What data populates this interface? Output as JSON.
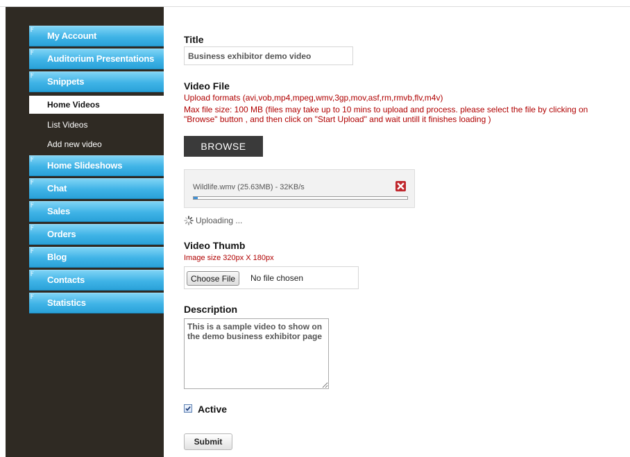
{
  "sidebar": {
    "items": [
      {
        "label": "My Account"
      },
      {
        "label": "Auditorium Presentations"
      },
      {
        "label": "Snippets"
      }
    ],
    "sub_items": [
      {
        "label": "Home Videos",
        "active": true
      },
      {
        "label": "List Videos"
      },
      {
        "label": "Add new video"
      }
    ],
    "items_after": [
      {
        "label": "Home Slideshows"
      },
      {
        "label": "Chat"
      },
      {
        "label": "Sales"
      },
      {
        "label": "Orders"
      },
      {
        "label": "Blog"
      },
      {
        "label": "Contacts"
      },
      {
        "label": "Statistics"
      }
    ]
  },
  "form": {
    "title_label": "Title",
    "title_value": "Business exhibitor demo video",
    "video_file_label": "Video File",
    "upload_formats": "Upload formats (avi,vob,mp4,mpeg,wmv,3gp,mov,asf,rm,rmvb,flv,m4v)",
    "max_size_note": "Max file size: 100 MB (files may take up to 10 mins to upload and process. please select the file by clicking on \"Browse\" button , and then click on \"Start Upload\" and wait untill it finishes loading )",
    "browse_label": "BROWSE",
    "upload_file": "Wildlife.wmv (25.63MB) - 32KB/s",
    "upload_progress": 0.02,
    "uploading_text": "Uploading ...",
    "thumb_label": "Video Thumb",
    "thumb_note": "Image size 320px X 180px",
    "choose_file_label": "Choose File",
    "no_file_text": "No file chosen",
    "description_label": "Description",
    "description_value": "This is a sample video to show on the demo business exhibitor page",
    "active_label": "Active",
    "active_checked": true,
    "submit_label": "Submit"
  },
  "colors": {
    "sidebar_bg": "#2f2a23",
    "nav_blue": "#3fb3e6",
    "note_red": "#b00000",
    "cancel_red": "#c0272d",
    "progress_blue": "#3a8fd8"
  }
}
